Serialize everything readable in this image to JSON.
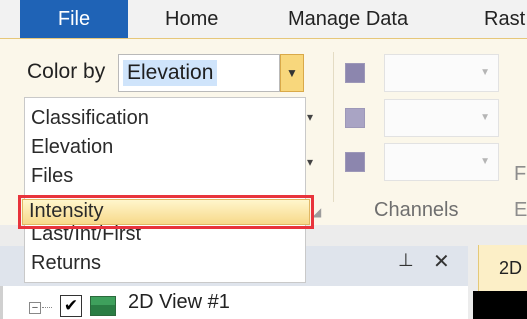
{
  "ribbon_tabs": [
    "File",
    "Home",
    "Manage Data",
    "Rast"
  ],
  "color_by": {
    "label": "Color by",
    "value": "Elevation"
  },
  "dropdown": {
    "items": [
      "Classification",
      "Elevation",
      "Files",
      "Intensity",
      "Last/Int/First",
      "Returns"
    ],
    "highlighted": "Intensity"
  },
  "groups": {
    "channels_label": "Channels",
    "partial_label_1": "F",
    "partial_label_2": "E"
  },
  "panel": {
    "doc_tab": "2D",
    "tree_item": "2D View #1",
    "tree_item_checked": true
  },
  "colors": {
    "file_tab": "#1f63b6",
    "ribbon_bg": "#fbf7ea",
    "highlight_border": "#e8343c"
  }
}
